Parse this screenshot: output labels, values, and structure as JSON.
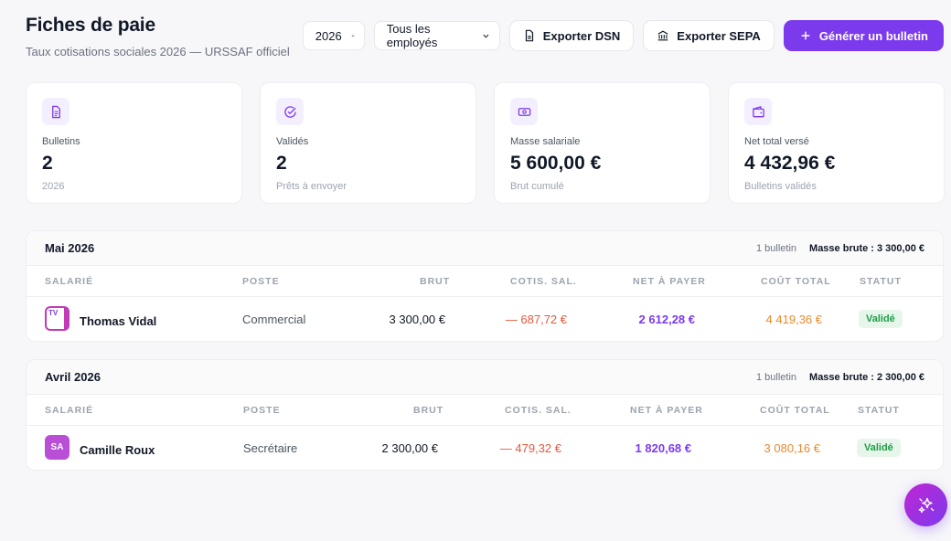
{
  "header": {
    "title": "Fiches de paie",
    "subtitle": "Taux cotisations sociales 2026 — URSSAF officiel"
  },
  "toolbar": {
    "year_select": "2026",
    "employee_select": "Tous les employés",
    "export_dsn": "Exporter DSN",
    "export_sepa": "Exporter SEPA",
    "generate": "Générer un bulletin"
  },
  "stats": [
    {
      "label": "Bulletins",
      "value": "2",
      "sub": "2026",
      "icon": "document-icon"
    },
    {
      "label": "Validés",
      "value": "2",
      "sub": "Prêts à envoyer",
      "icon": "check-circle-icon"
    },
    {
      "label": "Masse salariale",
      "value": "5 600,00 €",
      "sub": "Brut cumulé",
      "icon": "banknote-icon"
    },
    {
      "label": "Net total versé",
      "value": "4 432,96 €",
      "sub": "Bulletins validés",
      "icon": "wallet-icon"
    }
  ],
  "columns": {
    "salarie": "SALARIÉ",
    "poste": "POSTE",
    "brut": "BRUT",
    "cotis": "COTIS. SAL.",
    "net": "NET À PAYER",
    "cout": "COÛT TOTAL",
    "statut": "STATUT"
  },
  "sections": [
    {
      "title": "Mai 2026",
      "count": "1 bulletin",
      "gross": "Masse brute : 3 300,00 €",
      "rows": [
        {
          "initials": "TV",
          "name": "Thomas Vidal",
          "poste": "Commercial",
          "brut": "3 300,00 €",
          "cotis": "— 687,72 €",
          "net": "2 612,28 €",
          "cout": "4 419,36 €",
          "statut": "Validé"
        }
      ]
    },
    {
      "title": "Avril 2026",
      "count": "1 bulletin",
      "gross": "Masse brute : 2 300,00 €",
      "rows": [
        {
          "initials": "SA",
          "name": "Camille Roux",
          "poste": "Secrétaire",
          "brut": "2 300,00 €",
          "cotis": "— 479,32 €",
          "net": "1 820,68 €",
          "cout": "3 080,16 €",
          "statut": "Validé"
        }
      ]
    }
  ],
  "colors": {
    "accent": "#7c3aed",
    "negative": "#e4573d",
    "cost": "#ea8a2e",
    "success": "#1f9d46"
  }
}
